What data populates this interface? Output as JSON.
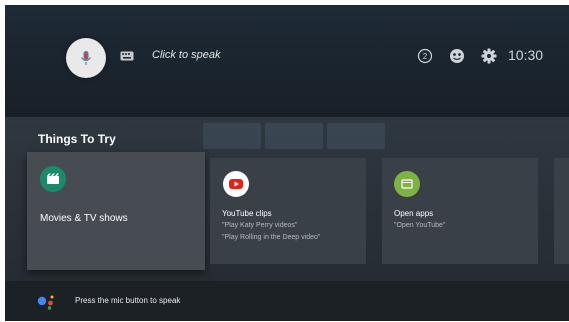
{
  "topbar": {
    "speak_prompt": "Click to speak",
    "clock": "10:30"
  },
  "section": {
    "title": "Things To Try"
  },
  "cards": [
    {
      "title": "Movies & TV shows",
      "lines": [],
      "icon": "movie-icon",
      "color": "#1b8a6b"
    },
    {
      "title": "YouTube clips",
      "lines": [
        "\"Play Katy Perry videos\"",
        "\"Play Rolling in the Deep video\""
      ],
      "icon": "youtube-icon",
      "color": "#e62117"
    },
    {
      "title": "Open apps",
      "lines": [
        "\"Open YouTube\""
      ],
      "icon": "apps-icon",
      "color": "#7cb342"
    }
  ],
  "bottom": {
    "hint": "Press the mic button to speak"
  }
}
